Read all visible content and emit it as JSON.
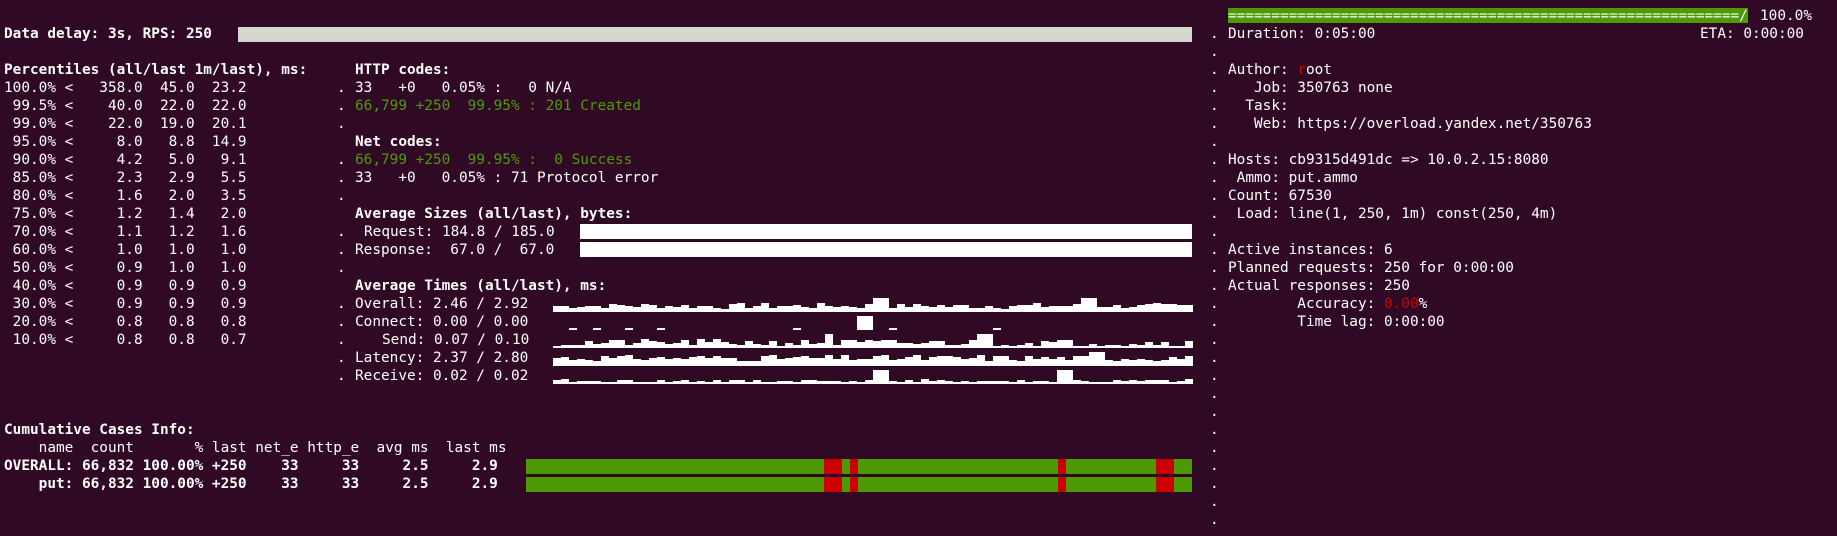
{
  "header": {
    "data_delay": "Data delay: 3s, RPS: 250"
  },
  "percentiles": {
    "title": "Percentiles (all/last 1m/last), ms:",
    "rows": [
      "100.0% <   358.0  45.0  23.2",
      " 99.5% <    40.0  22.0  22.0",
      " 99.0% <    22.0  19.0  20.1",
      " 95.0% <     8.0   8.8  14.9",
      " 90.0% <     4.2   5.0   9.1",
      " 85.0% <     2.3   2.9   5.5",
      " 80.0% <     1.6   2.0   3.5",
      " 75.0% <     1.2   1.4   2.0",
      " 70.0% <     1.1   1.2   1.6",
      " 60.0% <     1.0   1.0   1.0",
      " 50.0% <     0.9   1.0   1.0",
      " 40.0% <     0.9   0.9   0.9",
      " 30.0% <     0.9   0.9   0.9",
      " 20.0% <     0.8   0.8   0.8",
      " 10.0% <     0.8   0.8   0.7"
    ]
  },
  "http_codes": {
    "title": "HTTP codes:",
    "rows": [
      {
        "text": "33   +0   0.05% :   0 N/A",
        "color": "#ffffff"
      },
      {
        "text": "66,799 +250  99.95% : 201 Created",
        "color": "#4e9a06"
      }
    ]
  },
  "net_codes": {
    "title": "Net codes:",
    "rows": [
      {
        "text": "66,799 +250  99.95% :  0 Success",
        "color": "#4e9a06"
      },
      {
        "text": "33   +0   0.05% : 71 Protocol error",
        "color": "#ffffff"
      }
    ]
  },
  "sizes": {
    "title": "Average Sizes (all/last), bytes:",
    "request": "Request: 184.8 / 185.0",
    "response": "Response:  67.0 /  67.0"
  },
  "times": {
    "title": "Average Times (all/last), ms:",
    "overall": "Overall: 2.46 / 2.92",
    "connect": "Connect: 0.00 / 0.00",
    "send": "Send: 0.07 / 0.10",
    "latency": "Latency: 2.37 / 2.80",
    "receive": "Receive: 0.02 / 0.02"
  },
  "cases": {
    "title": "Cumulative Cases Info:",
    "header": "    name  count       % last net_e http_e  avg ms  last ms",
    "rows": [
      "OVERALL: 66,832 100.00% +250    33     33     2.5     2.9",
      "    put: 66,832 100.00% +250    33     33     2.5     2.9"
    ],
    "bar_colors": {
      "ok": "#4e9a06",
      "error": "#cc0000"
    }
  },
  "right": {
    "progress_bar": "===========================================================/",
    "progress_pct": "100.0%",
    "duration": "Duration: 0:05:00",
    "eta": "ETA: 0:00:00",
    "author_label": "Author: ",
    "author_first": "r",
    "author_rest": "oot",
    "job": "   Job: 350763 none",
    "task": "  Task:",
    "web": "   Web: https://overload.yandex.net/350763",
    "hosts": "Hosts: cb9315d491dc => 10.0.2.15:8080",
    "ammo": " Ammo: put.ammo",
    "count": "Count: 67530",
    "load": " Load: line(1, 250, 1m) const(250, 4m)",
    "active": "Active instances: 6",
    "planned": "Planned requests: 250 for 0:00:00",
    "actual": "Actual responses: 250",
    "accuracy_label": "        Accuracy: ",
    "accuracy_value": "0.00",
    "accuracy_pct": "%",
    "timelag": "        Time lag: 0:00:00"
  },
  "divider_char": "."
}
